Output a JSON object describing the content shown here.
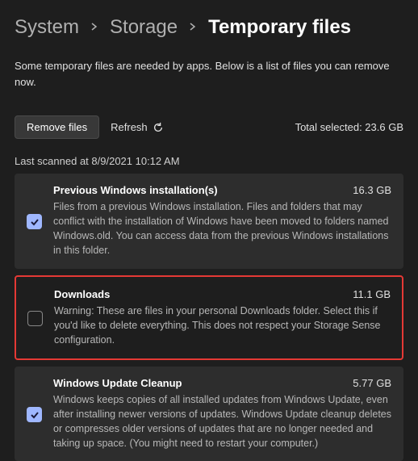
{
  "breadcrumb": {
    "a": "System",
    "b": "Storage",
    "c": "Temporary files"
  },
  "description": "Some temporary files are needed by apps. Below is a list of files you can remove now.",
  "toolbar": {
    "remove_label": "Remove files",
    "refresh_label": "Refresh",
    "total_label": "Total selected: 23.6 GB"
  },
  "last_scanned": "Last scanned at 8/9/2021 10:12 AM",
  "items": [
    {
      "title": "Previous Windows installation(s)",
      "size": "16.3 GB",
      "desc": "Files from a previous Windows installation.  Files and folders that may conflict with the installation of Windows have been moved to folders named Windows.old.  You can access data from the previous Windows installations in this folder."
    },
    {
      "title": "Downloads",
      "size": "11.1 GB",
      "desc": "Warning: These are files in your personal Downloads folder. Select this if you'd like to delete everything. This does not respect your Storage Sense configuration."
    },
    {
      "title": "Windows Update Cleanup",
      "size": "5.77 GB",
      "desc": "Windows keeps copies of all installed updates from Windows Update, even after installing newer versions of updates. Windows Update cleanup deletes or compresses older versions of updates that are no longer needed and taking up space. (You might need to restart your computer.)"
    }
  ]
}
